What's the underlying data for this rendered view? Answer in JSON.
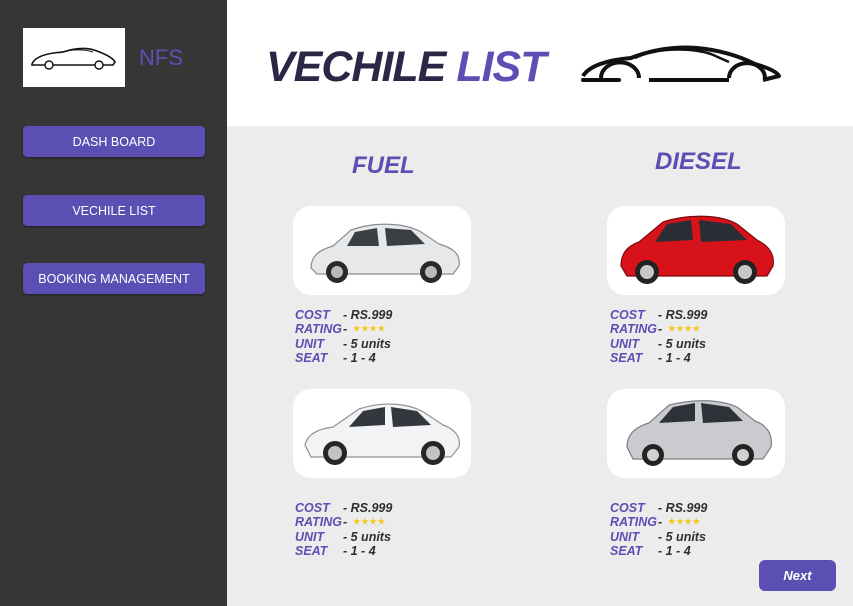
{
  "brand": {
    "name": "NFS",
    "logo_icon": "sports-car-logo-icon"
  },
  "sidebar": {
    "items": [
      {
        "label": "DASH BOARD"
      },
      {
        "label": "VECHILE LIST"
      },
      {
        "label": "BOOKING MANAGEMENT"
      }
    ]
  },
  "header": {
    "title_part1": "VECHILE",
    "title_part2": "LIST",
    "car_icon": "sports-car-silhouette-icon"
  },
  "columns": [
    {
      "title": "FUEL"
    },
    {
      "title": "DIESEL"
    }
  ],
  "spec_labels": {
    "cost": "COST",
    "rating": "RATING",
    "unit": "UNIT",
    "seat": "SEAT"
  },
  "cards": [
    {
      "column": "FUEL",
      "car_color": "#e6e8ea",
      "cost": "- RS.999",
      "rating_sep": "-",
      "stars": "★★★★",
      "unit": "- 5 units",
      "seat": "- 1 - 4"
    },
    {
      "column": "DIESEL",
      "car_color": "#d8121b",
      "cost": "- RS.999",
      "rating_sep": "-",
      "stars": "★★★★",
      "unit": "- 5 units",
      "seat": "- 1 - 4"
    },
    {
      "column": "FUEL",
      "car_color": "#f2f3f4",
      "cost": "- RS.999",
      "rating_sep": "-",
      "stars": "★★★★",
      "unit": "- 5 units",
      "seat": "- 1 - 4"
    },
    {
      "column": "DIESEL",
      "car_color": "#c9cbce",
      "cost": "- RS.999",
      "rating_sep": "-",
      "stars": "★★★★",
      "unit": "- 5 units",
      "seat": "- 1 - 4"
    }
  ],
  "footer": {
    "next_label": "Next"
  },
  "colors": {
    "accent": "#5b4fb4",
    "sidebar_bg": "#363636",
    "title_dark": "#2a2747",
    "star": "#f5c518"
  }
}
